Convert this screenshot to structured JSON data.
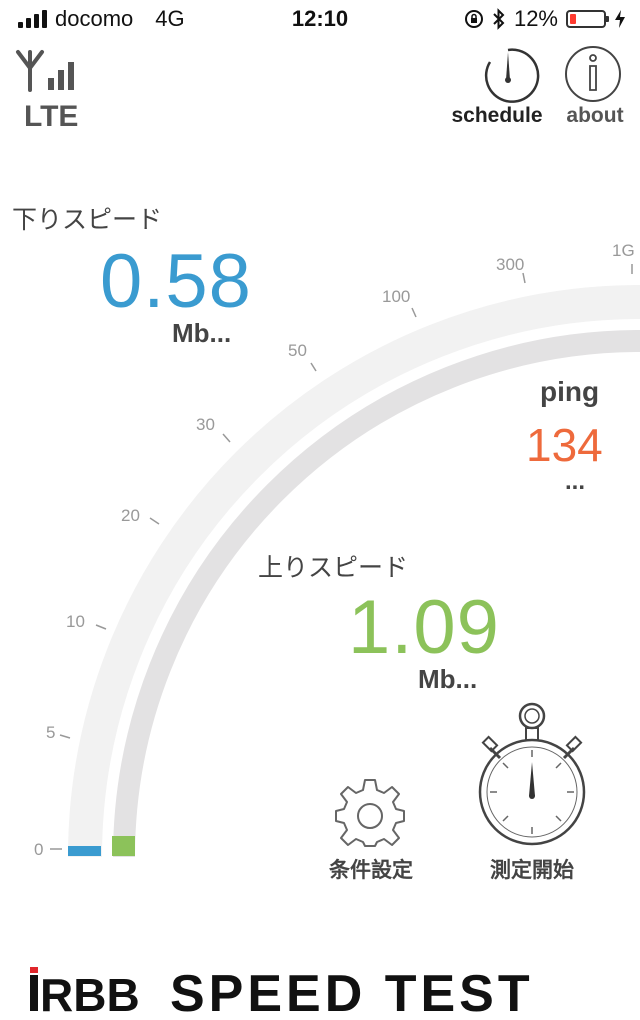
{
  "status_bar": {
    "carrier": "docomo",
    "network": "4G",
    "time": "12:10",
    "battery": "12%"
  },
  "network_type": "LTE",
  "buttons": {
    "schedule": "schedule",
    "about": "about",
    "settings": "条件設定",
    "start": "測定開始"
  },
  "download": {
    "label": "下りスピード",
    "value": "0.58",
    "unit": "Mb..."
  },
  "upload": {
    "label": "上りスピード",
    "value": "1.09",
    "unit": "Mb..."
  },
  "ping": {
    "label": "ping",
    "value": "134",
    "unit": "..."
  },
  "gauge": {
    "ticks": [
      "0",
      "5",
      "10",
      "20",
      "30",
      "50",
      "100",
      "300",
      "1G"
    ]
  },
  "footer": {
    "brand": "RBB",
    "title": "SPEED TEST"
  },
  "colors": {
    "download": "#3a9bd0",
    "upload": "#8cc25a",
    "ping": "#ee6a3c"
  }
}
